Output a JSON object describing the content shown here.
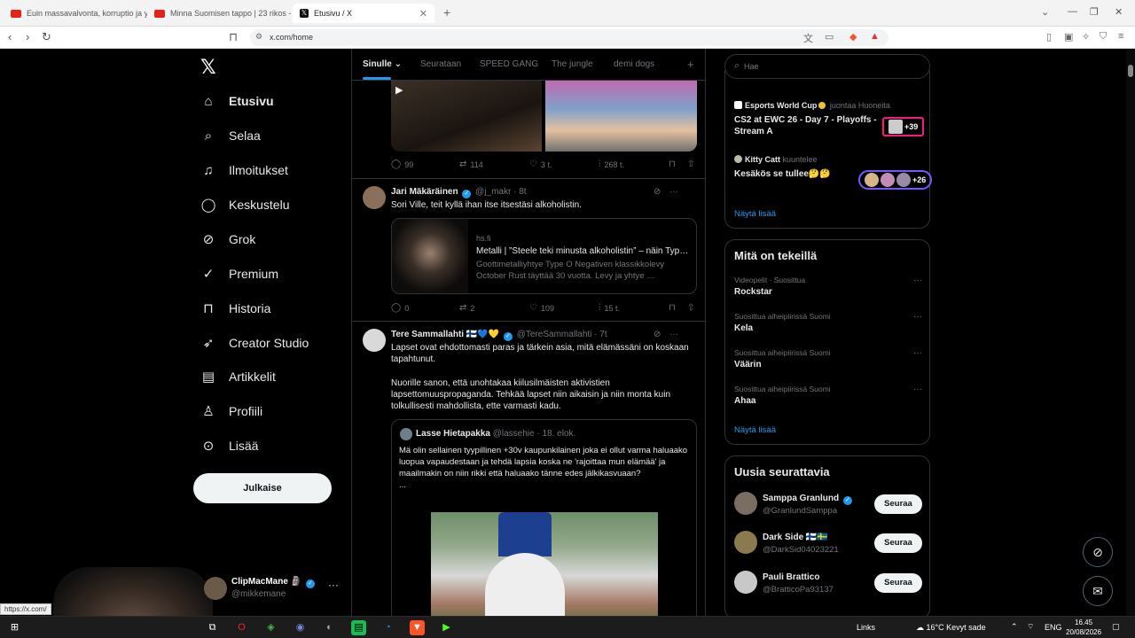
{
  "browser": {
    "tabs": [
      {
        "title": "Euin massavalvonta, korruptio ja yk…"
      },
      {
        "title": "Minna Suomisen tappo | 23 rikos - H"
      },
      {
        "title": "Etusivu / X"
      }
    ],
    "url": "x.com/home"
  },
  "nav": {
    "items": [
      {
        "label": "Etusivu",
        "icon": "home-icon"
      },
      {
        "label": "Selaa",
        "icon": "search-icon"
      },
      {
        "label": "Ilmoitukset",
        "icon": "bell-icon"
      },
      {
        "label": "Keskustelu",
        "icon": "chat-icon"
      },
      {
        "label": "Grok",
        "icon": "grok-icon"
      },
      {
        "label": "Premium",
        "icon": "verified-icon"
      },
      {
        "label": "Historia",
        "icon": "bookmark-icon"
      },
      {
        "label": "Creator Studio",
        "icon": "rocket-icon"
      },
      {
        "label": "Artikkelit",
        "icon": "article-icon"
      },
      {
        "label": "Profiili",
        "icon": "person-icon"
      },
      {
        "label": "Lisää",
        "icon": "more-circle-icon"
      }
    ],
    "post_button": "Julkaise",
    "account": {
      "name": "ClipMacMane 🗿",
      "handle": "@mikkemane"
    }
  },
  "feed": {
    "tabs": [
      "Sinulle",
      "Seurataan",
      "SPEED GANG",
      "The jungle",
      "demi dogs"
    ],
    "post0_actions": {
      "replies": "99",
      "reposts": "114",
      "likes": "3 t.",
      "views": "268 t."
    },
    "post1": {
      "name": "Jari Mäkäräinen",
      "meta": "@j_makr · 8t",
      "text": "Sori Ville, teit kyllä ihan itse itsestäsi alkoholistin.",
      "card": {
        "domain": "hs.fi",
        "title": "Metalli | ”Steele teki minusta alkoholistin” – näin Typ…",
        "desc": "Goottimetalliyhtye Type O Negativen klassikkolevy October Rust täyttää 30 vuotta. Levy ja yhtye …"
      },
      "actions": {
        "replies": "0",
        "reposts": "2",
        "likes": "109",
        "views": "15 t."
      }
    },
    "post2": {
      "name": "Tere Sammallahti 🇫🇮💙💛",
      "meta": "@TereSammallahti · 7t",
      "text1": "Lapset ovat ehdottomasti paras ja tärkein asia, mitä elämässäni on koskaan tapahtunut.",
      "text2": "Nuorille sanon, että unohtakaa kiilusilmäisten aktivistien lapsettomuuspropaganda. Tehkää lapset niin aikaisin ja niin monta kuin tolkullisesti mahdollista, ette varmasti kadu.",
      "quote": {
        "name": "Lasse Hietapakka",
        "meta": "@lassehie · 18. elok.",
        "text": "Mä olin sellainen tyypillinen +30v kaupunkilainen joka ei ollut varma haluaako luopua vapaudestaan ja tehdä lapsia koska ne 'rajoittaa mun elämää' ja maailmakin on niin rikki että haluaako tänne edes jälkikasvuaan?",
        "ellipsis": "..."
      }
    }
  },
  "right": {
    "search_placeholder": "Hae",
    "live": [
      {
        "who": "Esports World Cup",
        "action": "juontaa Huoneita",
        "title": "CS2 at EWC 26 - Day 7 - Playoffs - Stream A",
        "count": "+39"
      },
      {
        "who": "Kitty Catt",
        "action": "kuuntelee",
        "title": "Kesäkös se tullee🤔🤔",
        "count": "+26"
      }
    ],
    "live_more": "Näytä lisää",
    "trends_title": "Mitä on tekeillä",
    "trends": [
      {
        "context": "Videopelit · Suosittua",
        "topic": "Rockstar"
      },
      {
        "context": "Suosittua aiheipiirissä Suomi",
        "topic": "Kela"
      },
      {
        "context": "Suosittua aiheipiirissä Suomi",
        "topic": "Väärin"
      },
      {
        "context": "Suosittua aiheipiirissä Suomi",
        "topic": "Ahaa"
      }
    ],
    "trends_more": "Näytä lisää",
    "who_title": "Uusia seurattavia",
    "who": [
      {
        "name": "Samppa Granlund",
        "handle": "@GranlundSamppa",
        "button": "Seuraa"
      },
      {
        "name": "Dark Side 🇫🇮🇸🇪",
        "handle": "@DarkSid04023221",
        "button": "Seuraa"
      },
      {
        "name": "Pauli Brattico",
        "handle": "@BratticoPa93137",
        "button": "Seuraa"
      }
    ]
  },
  "status_link": "https://x.com/",
  "taskbar": {
    "links": "Links",
    "weather": "16°C  Kevyt sade",
    "lang": "ENG",
    "time": "16.45",
    "date": "20/08/2026"
  }
}
